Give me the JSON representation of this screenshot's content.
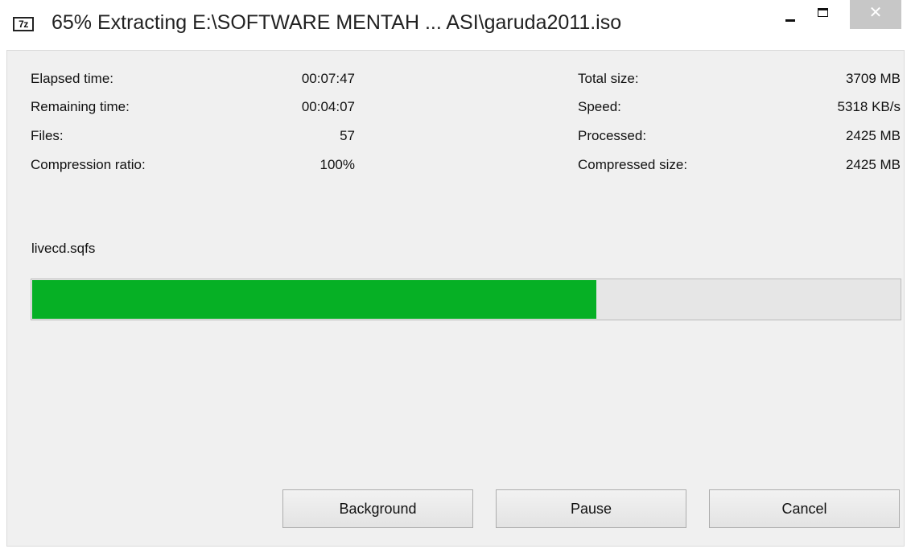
{
  "window": {
    "app_icon_text": "7z",
    "title": "65% Extracting E:\\SOFTWARE MENTAH ... ASI\\garuda2011.iso",
    "minimize_glyph": "",
    "maximize_glyph": "",
    "close_glyph": "✕"
  },
  "stats_left": [
    {
      "label": "Elapsed time:",
      "value": "00:07:47"
    },
    {
      "label": "Remaining time:",
      "value": "00:04:07"
    },
    {
      "label": "Files:",
      "value": "57"
    },
    {
      "label": "Compression ratio:",
      "value": "100%"
    }
  ],
  "stats_right": [
    {
      "label": "Total size:",
      "value": "3709 MB"
    },
    {
      "label": "Speed:",
      "value": "5318 KB/s"
    },
    {
      "label": "Processed:",
      "value": "2425 MB"
    },
    {
      "label": "Compressed size:",
      "value": "2425 MB"
    }
  ],
  "current_file": "livecd.sqfs",
  "progress": {
    "percent": 65,
    "fill_color": "#06b025"
  },
  "buttons": {
    "background": "Background",
    "pause": "Pause",
    "cancel": "Cancel"
  }
}
